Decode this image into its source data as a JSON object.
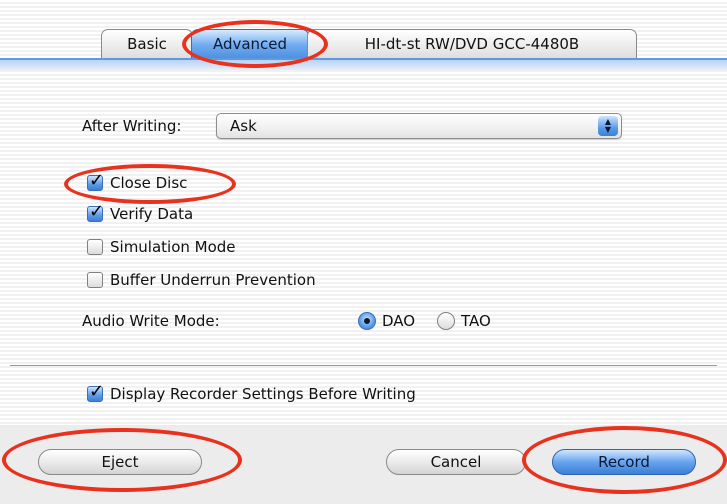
{
  "tabs": [
    {
      "label": "Basic"
    },
    {
      "label": "Advanced"
    },
    {
      "label": "HI-dt-st RW/DVD GCC-4480B"
    }
  ],
  "after_writing": {
    "label": "After Writing:",
    "value": "Ask"
  },
  "options": {
    "close_disc": {
      "label": "Close Disc",
      "checked": true
    },
    "verify_data": {
      "label": "Verify Data",
      "checked": true
    },
    "simulation_mode": {
      "label": "Simulation Mode",
      "checked": false
    },
    "buffer_underrun": {
      "label": "Buffer Underrun Prevention",
      "checked": false
    }
  },
  "audio_write_mode": {
    "label": "Audio Write Mode:",
    "options": [
      {
        "label": "DAO",
        "selected": true
      },
      {
        "label": "TAO",
        "selected": false
      }
    ]
  },
  "display_settings": {
    "label": "Display Recorder Settings Before Writing",
    "checked": true
  },
  "buttons": {
    "eject": "Eject",
    "cancel": "Cancel",
    "record": "Record"
  },
  "annotation_color": "#e8321e"
}
